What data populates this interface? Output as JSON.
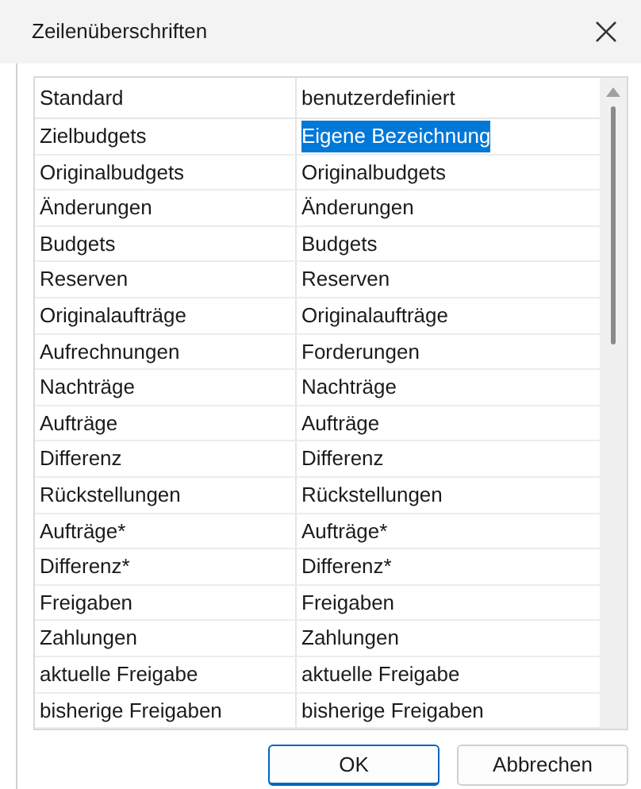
{
  "window": {
    "title": "Zeilenüberschriften"
  },
  "table": {
    "columns": [
      "Standard",
      "benutzerdefiniert"
    ],
    "rows": [
      {
        "standard": "Zielbudgets",
        "custom": "Eigene Bezeichnung",
        "selected": true
      },
      {
        "standard": "Originalbudgets",
        "custom": "Originalbudgets",
        "selected": false
      },
      {
        "standard": "Änderungen",
        "custom": "Änderungen",
        "selected": false
      },
      {
        "standard": "Budgets",
        "custom": "Budgets",
        "selected": false
      },
      {
        "standard": "Reserven",
        "custom": "Reserven",
        "selected": false
      },
      {
        "standard": "Originalaufträge",
        "custom": "Originalaufträge",
        "selected": false
      },
      {
        "standard": "Aufrechnungen",
        "custom": "Forderungen",
        "selected": false
      },
      {
        "standard": "Nachträge",
        "custom": "Nachträge",
        "selected": false
      },
      {
        "standard": "Aufträge",
        "custom": "Aufträge",
        "selected": false
      },
      {
        "standard": "Differenz",
        "custom": "Differenz",
        "selected": false
      },
      {
        "standard": "Rückstellungen",
        "custom": "Rückstellungen",
        "selected": false
      },
      {
        "standard": "Aufträge*",
        "custom": "Aufträge*",
        "selected": false
      },
      {
        "standard": "Differenz*",
        "custom": "Differenz*",
        "selected": false
      },
      {
        "standard": "Freigaben",
        "custom": "Freigaben",
        "selected": false
      },
      {
        "standard": "Zahlungen",
        "custom": "Zahlungen",
        "selected": false
      },
      {
        "standard": "aktuelle Freigabe",
        "custom": "aktuelle Freigabe",
        "selected": false
      },
      {
        "standard": "bisherige Freigaben",
        "custom": "bisherige Freigaben",
        "selected": false
      }
    ]
  },
  "buttons": [
    {
      "label": "OK",
      "default": true
    },
    {
      "label": "Abbrechen",
      "default": false
    }
  ]
}
